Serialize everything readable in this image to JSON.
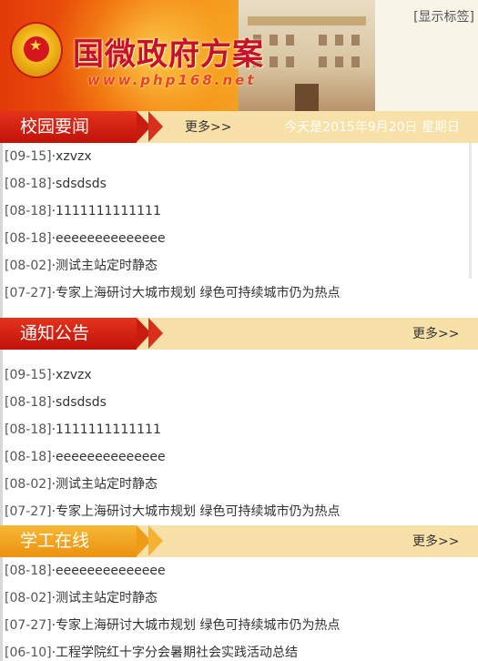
{
  "header": {
    "site_title": "国微政府方案",
    "site_url": "www.php168.net",
    "show_tags": "[显示标签]"
  },
  "sections": [
    {
      "title": "校园要闻",
      "more": "更多>>",
      "date_text": "今天是2015年9月20日 星期日",
      "items": [
        {
          "date": "[09-15]",
          "title": "·xzvzx"
        },
        {
          "date": "[08-18]",
          "title": "·sdsdsds"
        },
        {
          "date": "[08-18]",
          "title": "·1111111111111"
        },
        {
          "date": "[08-18]",
          "title": "·eeeeeeeeeeeeee"
        },
        {
          "date": "[08-02]",
          "title": "·测试主站定时静态"
        },
        {
          "date": "[07-27]",
          "title": "·专家上海研讨大城市规划 绿色可持续城市仍为热点"
        }
      ]
    },
    {
      "title": "通知公告",
      "more": "更多>>",
      "items": [
        {
          "date": "[09-15]",
          "title": "·xzvzx"
        },
        {
          "date": "[08-18]",
          "title": "·sdsdsds"
        },
        {
          "date": "[08-18]",
          "title": "·1111111111111"
        },
        {
          "date": "[08-18]",
          "title": "·eeeeeeeeeeeeee"
        },
        {
          "date": "[08-02]",
          "title": "·测试主站定时静态"
        },
        {
          "date": "[07-27]",
          "title": "·专家上海研讨大城市规划 绿色可持续城市仍为热点"
        }
      ]
    },
    {
      "title": "学工在线",
      "more": "更多>>",
      "items": [
        {
          "date": "[08-18]",
          "title": "·eeeeeeeeeeeeee"
        },
        {
          "date": "[08-02]",
          "title": "·测试主站定时静态"
        },
        {
          "date": "[07-27]",
          "title": "·专家上海研讨大城市规划 绿色可持续城市仍为热点"
        },
        {
          "date": "[06-10]",
          "title": "·工程学院红十字分会暑期社会实践活动总结"
        }
      ]
    }
  ],
  "colors": {
    "bar_bg": "#f7e1a9",
    "tab_red": "#c0120a",
    "tab_orange": "#ec9110",
    "title_red": "#c8102e"
  }
}
